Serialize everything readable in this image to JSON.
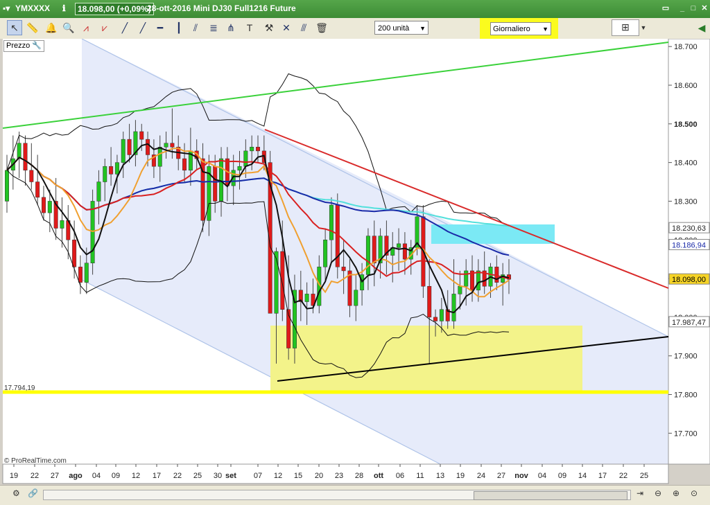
{
  "window": {
    "symbol": "YMXXXX",
    "last_price": "18.098,00 (+0,09%)",
    "title": "28-ott-2016  Mini DJ30 Full1216 Future"
  },
  "toolbar": {
    "units": "200 unità",
    "period": "Giornaliero"
  },
  "chart_labels": {
    "prezzo": "Prezzo",
    "copyright": "© ProRealTime.com",
    "hline_value": "17.794,19"
  },
  "chart_data": {
    "type": "candlestick",
    "x_tick_labels": [
      "19",
      "22",
      "27",
      "ago",
      "04",
      "09",
      "12",
      "17",
      "22",
      "25",
      "30",
      "set",
      "07",
      "12",
      "15",
      "20",
      "23",
      "28",
      "ott",
      "06",
      "11",
      "13",
      "19",
      "24",
      "27",
      "nov",
      "04",
      "09",
      "14",
      "17",
      "22",
      "25"
    ],
    "y_tick_labels": [
      "18.700",
      "18.600",
      "18.500",
      "18.400",
      "18.300",
      "18.200",
      "18.100",
      "18.000",
      "17.900",
      "17.800",
      "17.700"
    ],
    "ylim": [
      17620,
      18720
    ],
    "value_labels": [
      "18.230,63",
      "18.186,94",
      "18.098,00",
      "17.987,47"
    ],
    "candles": [
      [
        18300,
        18420,
        18270,
        18380
      ],
      [
        18380,
        18470,
        18330,
        18410
      ],
      [
        18410,
        18480,
        18360,
        18450
      ],
      [
        18450,
        18470,
        18340,
        18380
      ],
      [
        18380,
        18450,
        18330,
        18350
      ],
      [
        18350,
        18420,
        18290,
        18310
      ],
      [
        18310,
        18340,
        18250,
        18270
      ],
      [
        18270,
        18330,
        18220,
        18300
      ],
      [
        18300,
        18360,
        18200,
        18230
      ],
      [
        18230,
        18310,
        18180,
        18250
      ],
      [
        18250,
        18290,
        18150,
        18200
      ],
      [
        18200,
        18250,
        18100,
        18130
      ],
      [
        18130,
        18160,
        18060,
        18090
      ],
      [
        18090,
        18180,
        18060,
        18140
      ],
      [
        18140,
        18330,
        18110,
        18300
      ],
      [
        18300,
        18380,
        18240,
        18350
      ],
      [
        18350,
        18410,
        18300,
        18390
      ],
      [
        18390,
        18440,
        18340,
        18370
      ],
      [
        18370,
        18420,
        18320,
        18400
      ],
      [
        18400,
        18480,
        18360,
        18460
      ],
      [
        18460,
        18500,
        18400,
        18420
      ],
      [
        18420,
        18510,
        18390,
        18480
      ],
      [
        18480,
        18500,
        18430,
        18460
      ],
      [
        18460,
        18480,
        18390,
        18420
      ],
      [
        18420,
        18460,
        18360,
        18390
      ],
      [
        18390,
        18470,
        18350,
        18440
      ],
      [
        18440,
        18480,
        18410,
        18450
      ],
      [
        18450,
        18540,
        18410,
        18440
      ],
      [
        18440,
        18470,
        18380,
        18410
      ],
      [
        18410,
        18450,
        18350,
        18380
      ],
      [
        18380,
        18490,
        18340,
        18430
      ],
      [
        18430,
        18460,
        18380,
        18410
      ],
      [
        18410,
        18450,
        18220,
        18250
      ],
      [
        18250,
        18420,
        18210,
        18390
      ],
      [
        18390,
        18420,
        18270,
        18300
      ],
      [
        18300,
        18440,
        18260,
        18410
      ],
      [
        18410,
        18440,
        18300,
        18340
      ],
      [
        18340,
        18420,
        18290,
        18380
      ],
      [
        18380,
        18430,
        18330,
        18390
      ],
      [
        18390,
        18460,
        18360,
        18430
      ],
      [
        18430,
        18470,
        18380,
        18440
      ],
      [
        18440,
        18470,
        18400,
        18430
      ],
      [
        18430,
        18470,
        18380,
        18400
      ],
      [
        18400,
        18430,
        18300,
        18010
      ],
      [
        18010,
        18180,
        17880,
        18170
      ],
      [
        18170,
        18250,
        17990,
        18020
      ],
      [
        18020,
        18160,
        17890,
        17920
      ],
      [
        17920,
        18110,
        17880,
        18070
      ],
      [
        18070,
        18120,
        17990,
        18040
      ],
      [
        18040,
        18090,
        17980,
        18060
      ],
      [
        18060,
        18100,
        18010,
        18030
      ],
      [
        18030,
        18160,
        18010,
        18130
      ],
      [
        18130,
        18230,
        18090,
        18200
      ],
      [
        18200,
        18310,
        18140,
        18290
      ],
      [
        18290,
        18320,
        18100,
        18130
      ],
      [
        18130,
        18200,
        18060,
        18120
      ],
      [
        18120,
        18150,
        18000,
        18030
      ],
      [
        18030,
        18110,
        17990,
        18070
      ],
      [
        18070,
        18140,
        18030,
        18110
      ],
      [
        18110,
        18230,
        18070,
        18210
      ],
      [
        18210,
        18250,
        18080,
        18140
      ],
      [
        18140,
        18230,
        18100,
        18210
      ],
      [
        18210,
        18250,
        18110,
        18160
      ],
      [
        18160,
        18220,
        18090,
        18180
      ],
      [
        18180,
        18230,
        18120,
        18190
      ],
      [
        18190,
        18220,
        18110,
        18150
      ],
      [
        18150,
        18200,
        18110,
        18180
      ],
      [
        18180,
        18290,
        18160,
        18260
      ],
      [
        18260,
        18290,
        18050,
        18080
      ],
      [
        18080,
        18150,
        17880,
        18000
      ],
      [
        18000,
        18020,
        17950,
        17990
      ],
      [
        17990,
        18050,
        17960,
        18020
      ],
      [
        18020,
        18070,
        17970,
        17990
      ],
      [
        17990,
        18150,
        17970,
        18060
      ],
      [
        18060,
        18120,
        18020,
        18080
      ],
      [
        18080,
        18150,
        18030,
        18120
      ],
      [
        18120,
        18160,
        18040,
        18070
      ],
      [
        18070,
        18150,
        18040,
        18120
      ],
      [
        18120,
        18170,
        18060,
        18080
      ],
      [
        18080,
        18140,
        18050,
        18130
      ],
      [
        18130,
        18160,
        18070,
        18090
      ],
      [
        18090,
        18140,
        18030,
        18110
      ],
      [
        18110,
        18150,
        18060,
        18098
      ]
    ]
  },
  "colors": {
    "up_candle": "#22c322",
    "down_candle": "#e01a1a",
    "channel_fill": "#e6ebfa",
    "yellow_zone": "#f3f38a",
    "cyan_zone": "#7be9f5",
    "current_price_tag": "#f5d326"
  }
}
